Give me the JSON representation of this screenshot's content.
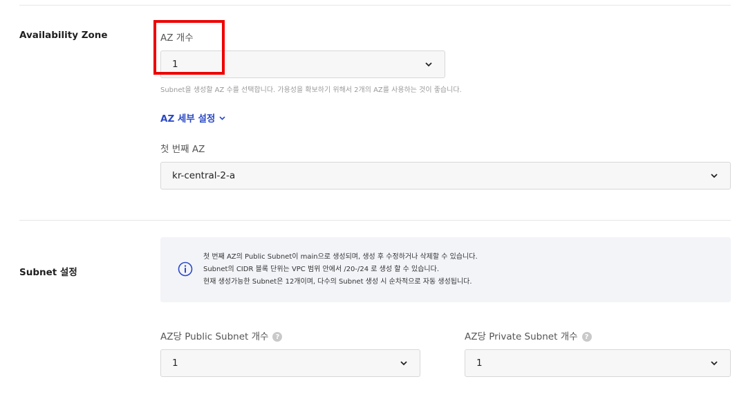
{
  "availability_zone": {
    "section_label": "Availability Zone",
    "az_count": {
      "label": "AZ 개수",
      "value": "1",
      "helper": "Subnet을 생성할 AZ 수를 선택합니다. 가용성을 확보하기 위해서 2개의 AZ를 사용하는 것이 좋습니다."
    },
    "detail_toggle": "AZ 세부 설정",
    "first_az": {
      "label": "첫 번째 AZ",
      "value": "kr-central-2-a"
    }
  },
  "subnet": {
    "section_label": "Subnet 설정",
    "info_lines": [
      "첫 번째 AZ의 Public Subnet이 main으로 생성되며, 생성 후 수정하거나 삭제할 수 있습니다.",
      "Subnet의 CIDR 블록 단위는 VPC 범위 안에서 /20-/24 로 생성 할 수 있습니다.",
      "현재 생성가능한 Subnet은 12개이며, 다수의 Subnet 생성 시 순차적으로 자동 생성됩니다."
    ],
    "public_count": {
      "label": "AZ당 Public Subnet 개수",
      "value": "1"
    },
    "private_count": {
      "label": "AZ당 Private Subnet 개수",
      "value": "1"
    },
    "help_glyph": "?"
  },
  "colors": {
    "highlight": "#ee0000",
    "link": "#2a49c6",
    "info_bg": "#f3f4f8",
    "select_bg": "#f7f7f8"
  }
}
